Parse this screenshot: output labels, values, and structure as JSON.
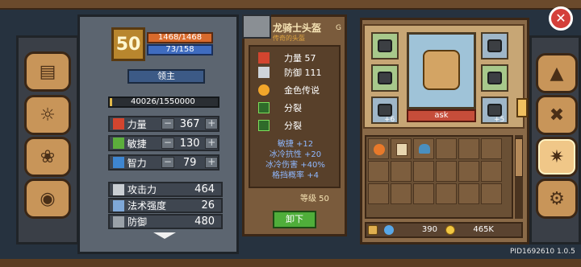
{
  "player": {
    "level": "50",
    "hp": "1468/1468",
    "mp": "73/158",
    "title": "领主",
    "exp": "40026/1550000",
    "exp_fraction": 0.026
  },
  "attributes": [
    {
      "label": "力量",
      "value": "367",
      "icon": "fist-icon",
      "color": "#d3452f"
    },
    {
      "label": "敏捷",
      "value": "130",
      "icon": "feather-icon",
      "color": "#5cae3c"
    },
    {
      "label": "智力",
      "value": "79",
      "icon": "book-icon",
      "color": "#3e86d1"
    }
  ],
  "stats": [
    {
      "label": "攻击力",
      "value": "464",
      "icon": "sword-icon"
    },
    {
      "label": "法术强度",
      "value": "26",
      "icon": "wand-icon"
    },
    {
      "label": "防御",
      "value": "480",
      "icon": "shield-icon"
    }
  ],
  "item": {
    "name": "龙骑士头盔",
    "quality": "传奇的头盔",
    "grade": "G",
    "base_stats": [
      {
        "label": "力量 57",
        "icon": "fist-icon"
      },
      {
        "label": "防御 111",
        "icon": "shield-icon"
      }
    ],
    "affixes": [
      {
        "label": "金色传说",
        "icon": "flame-icon"
      },
      {
        "label": "分裂",
        "icon": "split-icon"
      },
      {
        "label": "分裂",
        "icon": "split-icon"
      }
    ],
    "bonuses": [
      "敏捷 +12",
      "冰冷抗性 +20",
      "冰冷伤害 +40%",
      "格挡概率 +4"
    ],
    "level_req": "等级 50",
    "unequip_label": "卸下"
  },
  "hero": {
    "name": "ask",
    "slot_counts": [
      "+6",
      "+5"
    ]
  },
  "currency": {
    "gems": "390",
    "gold": "465K"
  },
  "footer": {
    "pid": "PID1692610 1.0.5"
  },
  "colors": {
    "accent": "#f0c788",
    "hp": "#d86a2c",
    "mp": "#3f6cc0",
    "bonus_text": "#8fb8ff"
  }
}
